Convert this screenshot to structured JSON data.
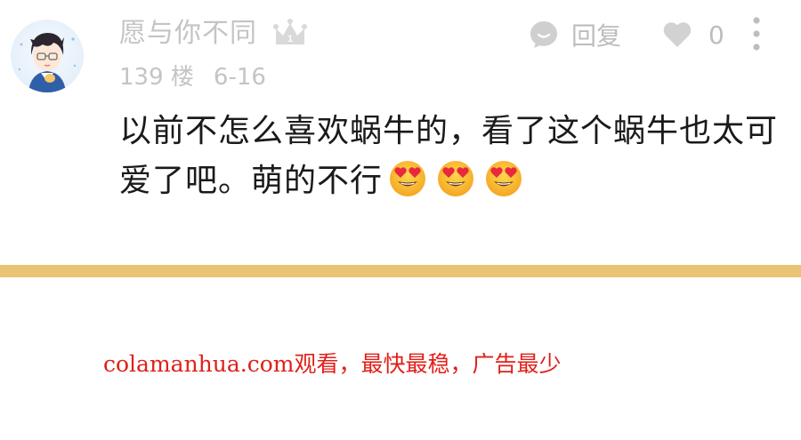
{
  "comment": {
    "username": "愿与你不同",
    "badge_level": "1",
    "floor": "139 楼",
    "date": "6-16",
    "reply_label": "回复",
    "like_count": "0",
    "content_text": "以前不怎么喜欢蜗牛的，看了这个蜗牛也太可爱了吧。萌的不行",
    "emojis": [
      "heart-eyes-emoji",
      "heart-eyes-emoji",
      "heart-eyes-emoji"
    ]
  },
  "theme": {
    "muted_text": "#c4c4c4",
    "divider": "#eac474",
    "ad_red": "#e0201a"
  },
  "footer": {
    "ad_text": "colamanhua.com观看，最快最稳，广告最少"
  }
}
